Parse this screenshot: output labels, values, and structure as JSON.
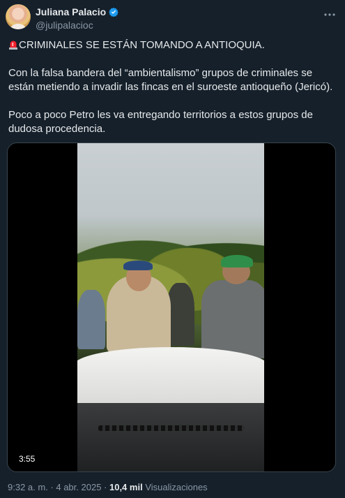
{
  "author": {
    "display_name": "Juliana Palacio",
    "handle": "@julipalacioc",
    "verified_icon": "verified-badge-icon",
    "avatar_icon": "avatar"
  },
  "header": {
    "more_icon": "more-horizontal-icon"
  },
  "tweet": {
    "paragraph1": "CRIMINALES SE ESTÁN TOMANDO A ANTIOQUIA.",
    "paragraph1_icon": "siren-icon",
    "paragraph2": "Con la falsa bandera del “ambientalismo” grupos de criminales se están metiendo a invadir las fincas en el suroeste antioqueño (Jericó).",
    "paragraph3": "Poco a poco Petro les va entregando territorios a estos grupos de dudosa procedencia."
  },
  "media": {
    "duration": "3:55"
  },
  "meta": {
    "timestamp": "9:32 a. m. · 4 abr. 2025 ·",
    "views_count": "10,4 mil",
    "views_label": "Visualizaciones"
  },
  "colors": {
    "background": "#15202b",
    "primary_text": "#e7e9ea",
    "secondary_text": "#8b98a5",
    "verified": "#1d9bf0",
    "siren": "#f4212e"
  }
}
